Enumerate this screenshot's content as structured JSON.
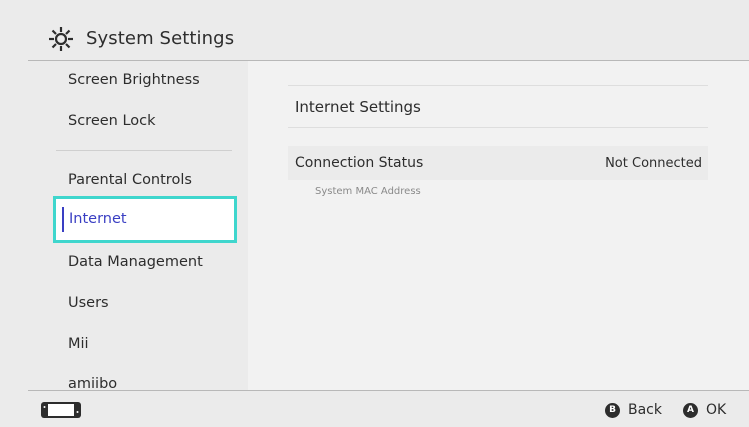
{
  "header": {
    "title": "System Settings",
    "icon": "gear-icon"
  },
  "sidebar": {
    "items": [
      {
        "label": "Screen Brightness"
      },
      {
        "label": "Screen Lock"
      },
      {
        "label": "Parental Controls"
      },
      {
        "label": "Internet",
        "selected": true
      },
      {
        "label": "Data Management"
      },
      {
        "label": "Users"
      },
      {
        "label": "Mii"
      },
      {
        "label": "amiibo"
      }
    ],
    "selected_color": "#3a3fc3",
    "focus_border_color": "#3fd6cd"
  },
  "main": {
    "section_title": "Internet Settings",
    "connection_status_label": "Connection Status",
    "connection_status_value": "Not Connected",
    "mac_label": "System MAC Address"
  },
  "footer": {
    "console_icon": "console-icon",
    "back_button_glyph": "B",
    "back_label": "Back",
    "ok_button_glyph": "A",
    "ok_label": "OK"
  }
}
